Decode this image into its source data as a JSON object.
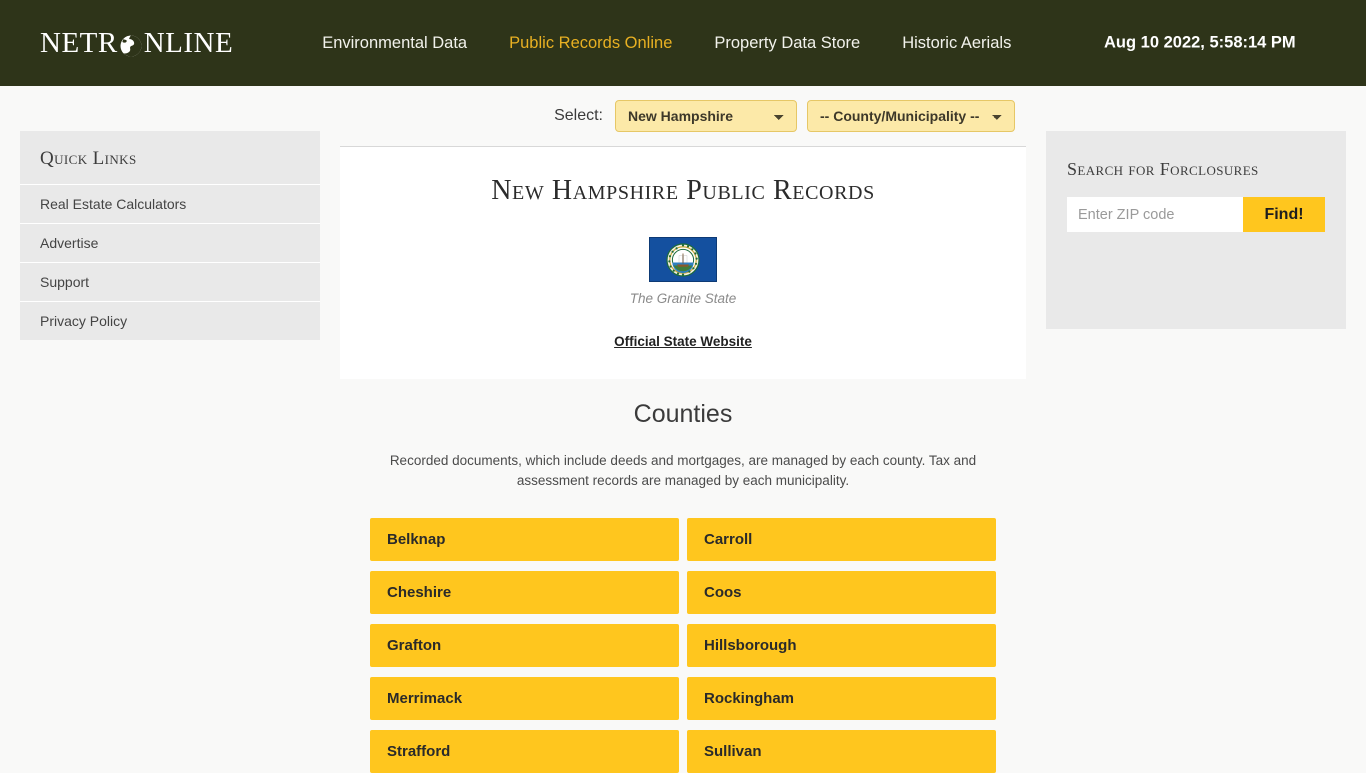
{
  "header": {
    "logo": {
      "prefix": "NETR",
      "icon": "globe-icon",
      "suffix": "NLINE"
    },
    "nav": [
      {
        "label": "Environmental Data",
        "active": false
      },
      {
        "label": "Public Records Online",
        "active": true
      },
      {
        "label": "Property Data Store",
        "active": false
      },
      {
        "label": "Historic Aerials",
        "active": false
      }
    ],
    "clock": "Aug 10 2022, 5:58:14 PM",
    "background_color": "#2e3419",
    "active_color": "#e8b022"
  },
  "quick_links": {
    "title": "Quick Links",
    "items": [
      {
        "label": "Real Estate Calculators"
      },
      {
        "label": "Advertise"
      },
      {
        "label": "Support"
      },
      {
        "label": "Privacy Policy"
      }
    ]
  },
  "selector": {
    "label": "Select:",
    "state_value": "New Hampshire",
    "state_options": [
      "New Hampshire"
    ],
    "county_value": "-- County/Municipality --",
    "county_options": [
      "-- County/Municipality --"
    ]
  },
  "record_card": {
    "title": "New Hampshire Public Records",
    "flag_alt": "new-hampshire-flag",
    "nickname": "The Granite State",
    "official_link": "Official State Website"
  },
  "counties": {
    "title": "Counties",
    "description": "Recorded documents, which include deeds and mortgages, are managed by each county. Tax and assessment records are managed by each municipality.",
    "items": [
      "Belknap",
      "Carroll",
      "Cheshire",
      "Coos",
      "Grafton",
      "Hillsborough",
      "Merrimack",
      "Rockingham",
      "Strafford",
      "Sullivan"
    ],
    "button_color": "#ffc61e"
  },
  "foreclosures": {
    "title": "Search for Forclosures",
    "zip_placeholder": "Enter ZIP code",
    "zip_value": "",
    "find_label": "Find!"
  }
}
